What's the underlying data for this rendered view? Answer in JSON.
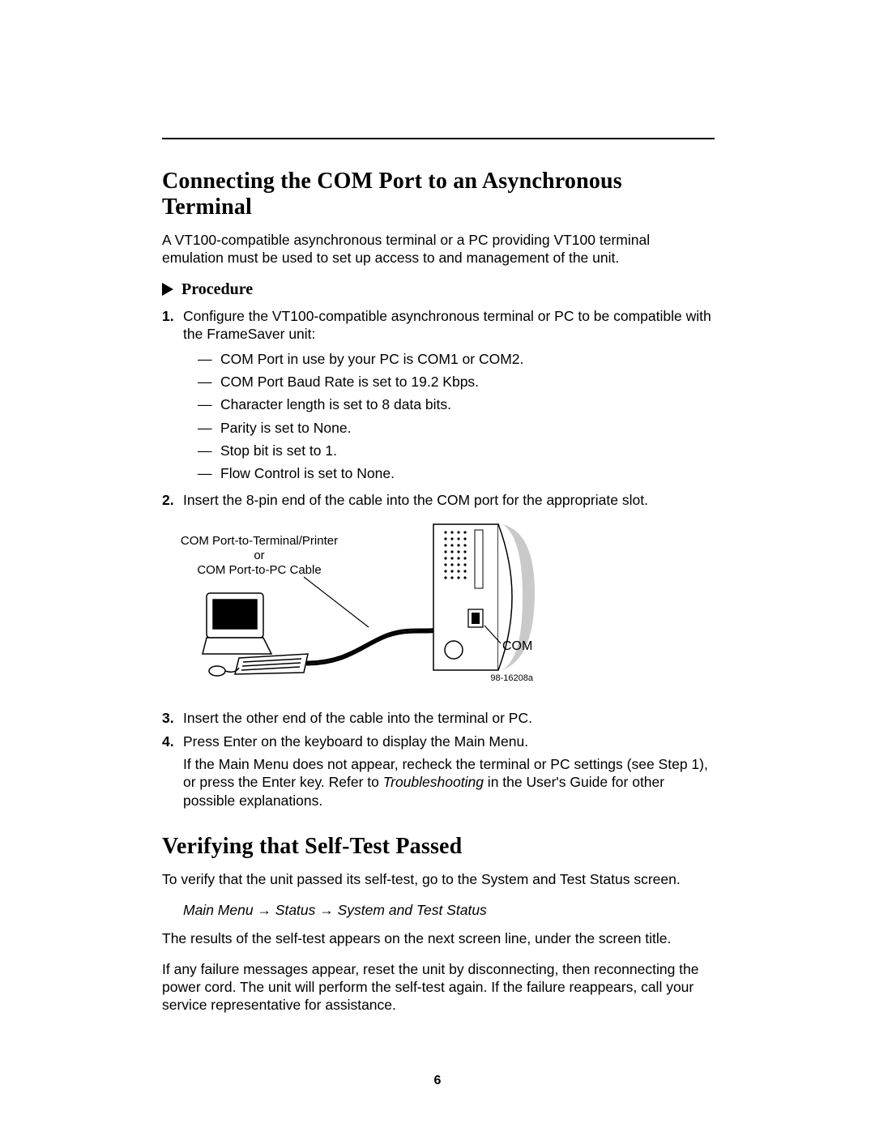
{
  "section1": {
    "title": "Connecting the COM Port to an Asynchronous Terminal",
    "intro": "A VT100-compatible asynchronous terminal or a PC providing VT100 terminal emulation must be used to set up access to and management of the unit.",
    "procedure_label": "Procedure",
    "steps": {
      "s1": "Configure the VT100-compatible asynchronous terminal or PC to be compatible with the FrameSaver unit:",
      "s1_items": [
        "COM Port in use by your PC is COM1 or COM2.",
        "COM Port Baud Rate is set to 19.2 Kbps.",
        "Character length is set to 8 data bits.",
        "Parity is set to None.",
        "Stop bit is set to 1.",
        "Flow Control is set to None."
      ],
      "s2": "Insert the 8-pin end of the cable into the COM port for the appropriate slot.",
      "s3": "Insert the other end of the cable into the terminal or PC.",
      "s4": "Press Enter on the keyboard to display the Main Menu.",
      "s4_extra_a": "If the Main Menu does not appear, recheck the terminal or PC settings (see Step 1), or press the Enter key. Refer to ",
      "s4_extra_italic": "Troubleshooting",
      "s4_extra_b": " in the User's Guide for other possible explanations."
    }
  },
  "diagram": {
    "cable_label_1": "COM Port-to-Terminal/Printer",
    "cable_label_or": "or",
    "cable_label_2": "COM Port-to-PC Cable",
    "com_label": "COM",
    "figure_id": "98-16208a"
  },
  "section2": {
    "title": "Verifying that Self-Test Passed",
    "p1": "To verify that the unit passed its self-test, go to the System and Test Status screen.",
    "nav": "Main Menu → Status → System and Test Status",
    "p2": "The results of the self-test appears on the next screen line, under the screen title.",
    "p3": "If any failure messages appear, reset the unit by disconnecting, then reconnecting the power cord. The unit will perform the self-test again. If the failure reappears, call your service representative for assistance."
  },
  "page_number": "6"
}
